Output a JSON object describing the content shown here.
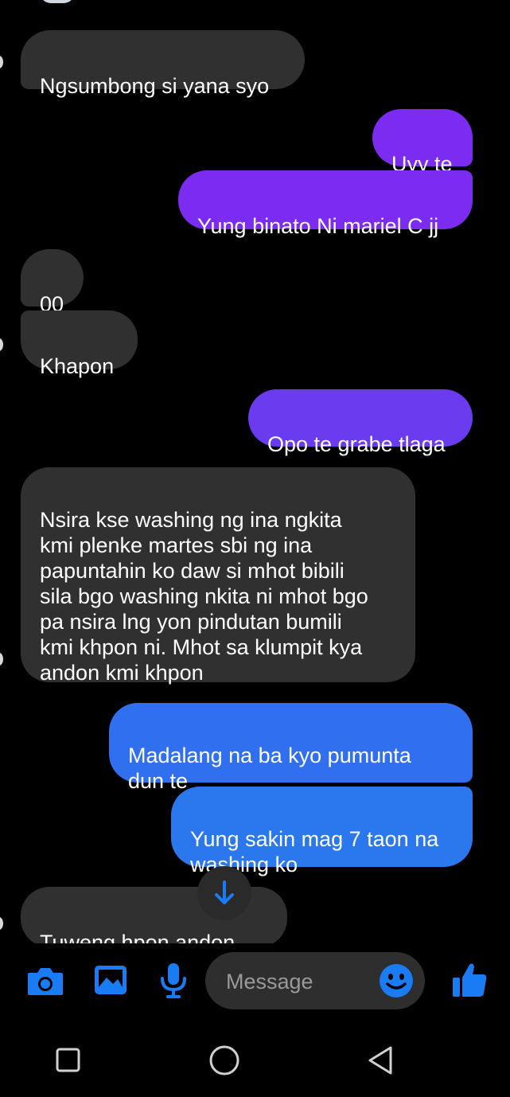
{
  "messages": [
    {
      "side": "received",
      "text": "Ngsumbong si yana syo"
    },
    {
      "side": "sent",
      "text": "Uyy te"
    },
    {
      "side": "sent",
      "text": "Yung binato Ni mariel C jj"
    },
    {
      "side": "received",
      "text": "00"
    },
    {
      "side": "received",
      "text": "Khapon"
    },
    {
      "side": "sent",
      "text": "Opo te grabe tlaga"
    },
    {
      "side": "received",
      "text": "Nsira kse washing ng ina ngkita\nkmi plenke martes sbi ng ina\npapuntahin ko daw si mhot bibili\nsila bgo washing nkita ni mhot bgo\npa nsira lng yon pindutan bumili\nkmi khpon ni. Mhot sa klumpit kya\nandon kmi khpon"
    },
    {
      "side": "sent",
      "text": "Madalang na ba kyo pumunta\ndun te"
    },
    {
      "side": "sent",
      "text": "Yung sakin mag 7 taon na\nwashing ko"
    },
    {
      "side": "received",
      "text": "Tuweng hpon andon kmi"
    }
  ],
  "composer": {
    "placeholder": "Message",
    "icons": [
      "camera-icon",
      "gallery-icon",
      "microphone-icon",
      "emoji-icon",
      "thumbs-up-icon"
    ]
  },
  "navbar": {
    "icons": [
      "recent-apps-icon",
      "home-icon",
      "back-icon"
    ]
  },
  "colors": {
    "received_bubble": "#303030",
    "sent_purple": "#7b2cf0",
    "sent_violet": "#6a3bef",
    "sent_blue": "#2f6ff0",
    "accent": "#1a7cf5"
  }
}
